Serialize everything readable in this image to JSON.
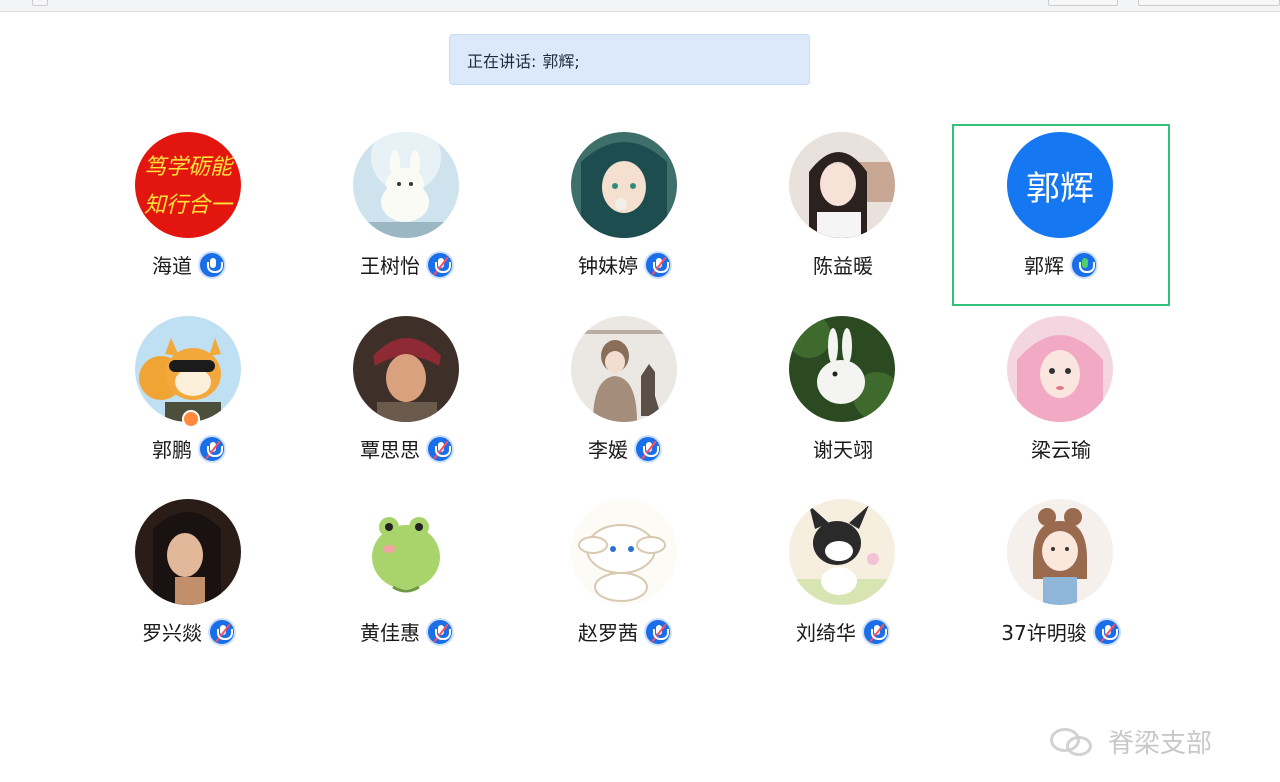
{
  "speaking": {
    "label": "正在讲话:",
    "names": "郭辉;"
  },
  "participants": [
    {
      "name": "海道",
      "mic": "on"
    },
    {
      "name": "王树怡",
      "mic": "muted"
    },
    {
      "name": "钟妹婷",
      "mic": "muted"
    },
    {
      "name": "陈益暖",
      "mic": "none"
    },
    {
      "name": "郭辉",
      "mic": "live",
      "avatar_text": "郭辉",
      "active": true
    },
    {
      "name": "郭鹏",
      "mic": "muted",
      "host_badge": true
    },
    {
      "name": "覃思思",
      "mic": "muted"
    },
    {
      "name": "李媛",
      "mic": "muted"
    },
    {
      "name": "谢天翊",
      "mic": "none"
    },
    {
      "name": "梁云瑜",
      "mic": "none"
    },
    {
      "name": "罗兴燚",
      "mic": "muted"
    },
    {
      "name": "黄佳惠",
      "mic": "muted"
    },
    {
      "name": "赵罗茜",
      "mic": "muted"
    },
    {
      "name": "刘绮华",
      "mic": "muted"
    },
    {
      "name": "37许明骏",
      "mic": "muted"
    }
  ],
  "avatar_0_text": "笃学砺能 知行合一",
  "watermark": "脊梁支部",
  "colors": {
    "accent": "#1677f2",
    "active_border": "#34c27b",
    "speaking_bg": "#dbe9fb"
  }
}
